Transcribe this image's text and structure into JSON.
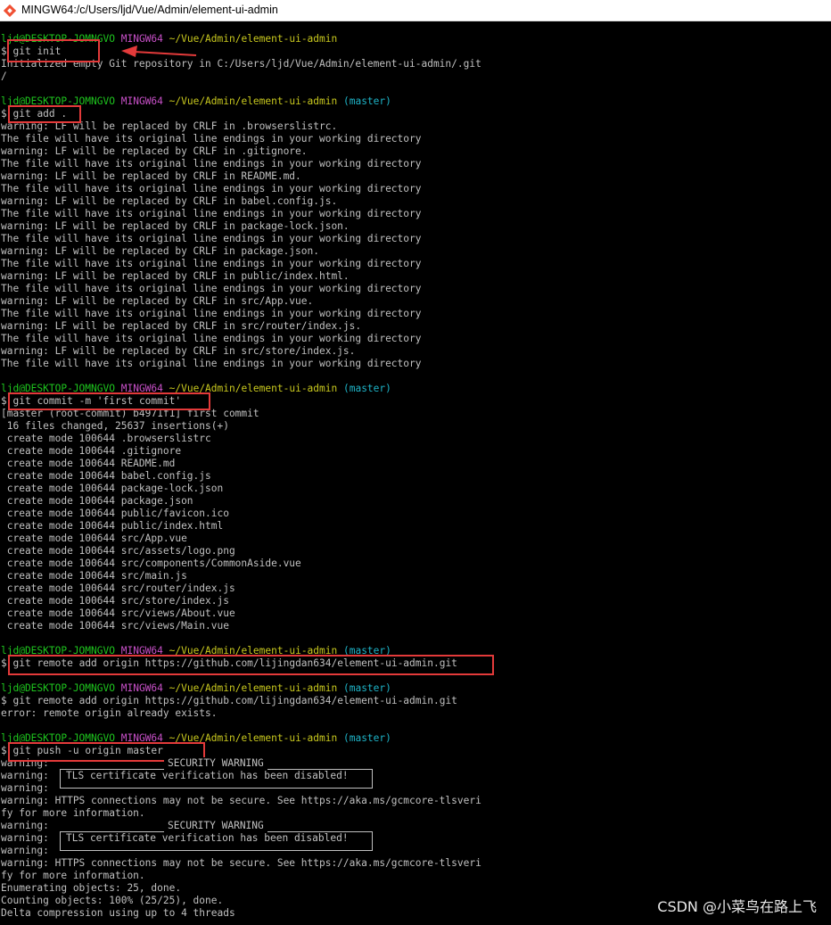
{
  "window": {
    "title": "MINGW64:/c/Users/ljd/Vue/Admin/element-ui-admin"
  },
  "prompt": {
    "user": "ljd@DESKTOP-JOMNGVO",
    "host": "MINGW64",
    "path": "~/Vue/Admin/element-ui-admin",
    "branch": "(master)",
    "symbol": "$"
  },
  "cmd": {
    "init": "git init",
    "add": "git add .",
    "commit": "git commit -m 'first commit'",
    "remote1": "git remote add origin https://github.com/lijingdan634/element-ui-admin.git",
    "remote2": "git remote add origin https://github.com/lijingdan634/element-ui-admin.git",
    "push": "git push -u origin master"
  },
  "out": {
    "init": [
      "Initialized empty Git repository in C:/Users/ljd/Vue/Admin/element-ui-admin/.git",
      "/"
    ],
    "add": [
      "warning: LF will be replaced by CRLF in .browserslistrc.",
      "The file will have its original line endings in your working directory",
      "warning: LF will be replaced by CRLF in .gitignore.",
      "The file will have its original line endings in your working directory",
      "warning: LF will be replaced by CRLF in README.md.",
      "The file will have its original line endings in your working directory",
      "warning: LF will be replaced by CRLF in babel.config.js.",
      "The file will have its original line endings in your working directory",
      "warning: LF will be replaced by CRLF in package-lock.json.",
      "The file will have its original line endings in your working directory",
      "warning: LF will be replaced by CRLF in package.json.",
      "The file will have its original line endings in your working directory",
      "warning: LF will be replaced by CRLF in public/index.html.",
      "The file will have its original line endings in your working directory",
      "warning: LF will be replaced by CRLF in src/App.vue.",
      "The file will have its original line endings in your working directory",
      "warning: LF will be replaced by CRLF in src/router/index.js.",
      "The file will have its original line endings in your working directory",
      "warning: LF will be replaced by CRLF in src/store/index.js.",
      "The file will have its original line endings in your working directory"
    ],
    "commit": [
      "[master (root-commit) b4971f1] first commit",
      " 16 files changed, 25637 insertions(+)",
      " create mode 100644 .browserslistrc",
      " create mode 100644 .gitignore",
      " create mode 100644 README.md",
      " create mode 100644 babel.config.js",
      " create mode 100644 package-lock.json",
      " create mode 100644 package.json",
      " create mode 100644 public/favicon.ico",
      " create mode 100644 public/index.html",
      " create mode 100644 src/App.vue",
      " create mode 100644 src/assets/logo.png",
      " create mode 100644 src/components/CommonAside.vue",
      " create mode 100644 src/main.js",
      " create mode 100644 src/router/index.js",
      " create mode 100644 src/store/index.js",
      " create mode 100644 src/views/About.vue",
      " create mode 100644 src/views/Main.vue"
    ],
    "remote2": [
      "error: remote origin already exists."
    ],
    "push": [
      "warning: ",
      "warning: ",
      "warning: ",
      "warning: HTTPS connections may not be secure. See https://aka.ms/gcmcore-tlsveri",
      "fy for more information.",
      "warning: ",
      "warning: ",
      "warning: ",
      "warning: HTTPS connections may not be secure. See https://aka.ms/gcmcore-tlsveri",
      "fy for more information.",
      "Enumerating objects: 25, done.",
      "Counting objects: 100% (25/25), done.",
      "Delta compression using up to 4 threads"
    ],
    "security_warning": "SECURITY WARNING",
    "tls_message": "TLS certificate verification has been disabled!"
  },
  "watermark": "CSDN @小菜鸟在路上飞"
}
